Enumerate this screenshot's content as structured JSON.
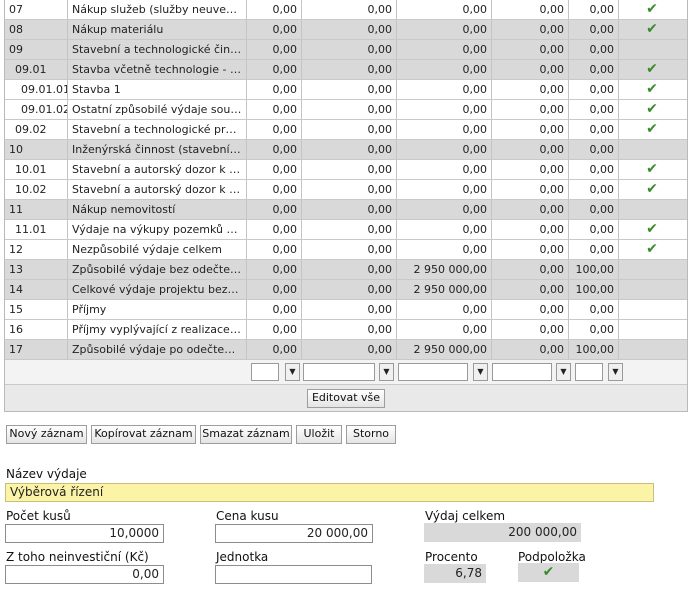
{
  "rows": [
    {
      "code": "07",
      "name": "Nákup služeb (služby neuvedené)",
      "v1": "0,00",
      "v2": "0,00",
      "v3": "0,00",
      "v4": "0,00",
      "v5": "0,00",
      "check": "✔",
      "style": "white",
      "indent": ""
    },
    {
      "code": "08",
      "name": "Nákup materiálu",
      "v1": "0,00",
      "v2": "0,00",
      "v3": "0,00",
      "v4": "0,00",
      "v5": "0,00",
      "check": "✔",
      "style": "gray",
      "indent": ""
    },
    {
      "code": "09",
      "name": "Stavební a technologické činnosti",
      "v1": "0,00",
      "v2": "0,00",
      "v3": "0,00",
      "v4": "0,00",
      "v5": "0,00",
      "check": "",
      "style": "gray",
      "indent": ""
    },
    {
      "code": "09.01",
      "name": "Stavba včetně technologie - investice",
      "v1": "0,00",
      "v2": "0,00",
      "v3": "0,00",
      "v4": "0,00",
      "v5": "0,00",
      "check": "✔",
      "style": "gray",
      "indent": "sub"
    },
    {
      "code": "09.01.01",
      "name": "Stavba 1",
      "v1": "0,00",
      "v2": "0,00",
      "v3": "0,00",
      "v4": "0,00",
      "v5": "0,00",
      "check": "✔",
      "style": "white",
      "indent": "subsub"
    },
    {
      "code": "09.01.02",
      "name": "Ostatní způsobilé výdaje souvisejí",
      "v1": "0,00",
      "v2": "0,00",
      "v3": "0,00",
      "v4": "0,00",
      "v5": "0,00",
      "check": "✔",
      "style": "white",
      "indent": "subsub"
    },
    {
      "code": "09.02",
      "name": "Stavební a technologické práce",
      "v1": "0,00",
      "v2": "0,00",
      "v3": "0,00",
      "v4": "0,00",
      "v5": "0,00",
      "check": "✔",
      "style": "white",
      "indent": "sub"
    },
    {
      "code": "10",
      "name": "Inženýrská činnost (stavební dozor)",
      "v1": "0,00",
      "v2": "0,00",
      "v3": "0,00",
      "v4": "0,00",
      "v5": "0,00",
      "check": "",
      "style": "gray",
      "indent": ""
    },
    {
      "code": "10.01",
      "name": "Stavební a autorský dozor k pořízení",
      "v1": "0,00",
      "v2": "0,00",
      "v3": "0,00",
      "v4": "0,00",
      "v5": "0,00",
      "check": "✔",
      "style": "white",
      "indent": "sub"
    },
    {
      "code": "10.02",
      "name": "Stavební a autorský dozor k neinvestičním",
      "v1": "0,00",
      "v2": "0,00",
      "v3": "0,00",
      "v4": "0,00",
      "v5": "0,00",
      "check": "✔",
      "style": "white",
      "indent": "sub"
    },
    {
      "code": "11",
      "name": "Nákup nemovitostí",
      "v1": "0,00",
      "v2": "0,00",
      "v3": "0,00",
      "v4": "0,00",
      "v5": "0,00",
      "check": "",
      "style": "gray",
      "indent": ""
    },
    {
      "code": "11.01",
      "name": "Výdaje na výkupy pozemků vč. souvisejících",
      "v1": "0,00",
      "v2": "0,00",
      "v3": "0,00",
      "v4": "0,00",
      "v5": "0,00",
      "check": "✔",
      "style": "white",
      "indent": "sub"
    },
    {
      "code": "12",
      "name": "Nezpůsobilé výdaje celkem",
      "v1": "0,00",
      "v2": "0,00",
      "v3": "0,00",
      "v4": "0,00",
      "v5": "0,00",
      "check": "✔",
      "style": "white",
      "indent": ""
    },
    {
      "code": "13",
      "name": "Způsobilé výdaje bez odečtení příjmů",
      "v1": "0,00",
      "v2": "0,00",
      "v3": "2 950 000,00",
      "v4": "0,00",
      "v5": "100,00",
      "check": "",
      "style": "gray",
      "indent": ""
    },
    {
      "code": "14",
      "name": "Celkové výdaje projektu bez odečtení",
      "v1": "0,00",
      "v2": "0,00",
      "v3": "2 950 000,00",
      "v4": "0,00",
      "v5": "100,00",
      "check": "",
      "style": "gray",
      "indent": ""
    },
    {
      "code": "15",
      "name": "Příjmy",
      "v1": "0,00",
      "v2": "0,00",
      "v3": "0,00",
      "v4": "0,00",
      "v5": "0,00",
      "check": "",
      "style": "white",
      "indent": ""
    },
    {
      "code": "16",
      "name": "Příjmy vyplývající z realizace projektu",
      "v1": "0,00",
      "v2": "0,00",
      "v3": "0,00",
      "v4": "0,00",
      "v5": "0,00",
      "check": "",
      "style": "white",
      "indent": ""
    },
    {
      "code": "17",
      "name": "Způsobilé výdaje po odečtení příjmů",
      "v1": "0,00",
      "v2": "0,00",
      "v3": "2 950 000,00",
      "v4": "0,00",
      "v5": "100,00",
      "check": "",
      "style": "gray",
      "indent": ""
    }
  ],
  "filter_arrow": "▼",
  "edit_all_label": "Editovat vše",
  "actions": {
    "new": "Nový záznam",
    "copy": "Kopírovat záznam",
    "delete": "Smazat záznam",
    "save": "Uložit",
    "cancel": "Storno"
  },
  "form": {
    "name_label": "Název výdaje",
    "name_value": "Výběrová řízení",
    "qty_label": "Počet kusů",
    "qty_value": "10,0000",
    "price_label": "Cena kusu",
    "price_value": "20 000,00",
    "total_label": "Výdaj celkem",
    "total_value": "200 000,00",
    "noninvest_label": "Z toho neinvestiční (Kč)",
    "noninvest_value": "0,00",
    "unit_label": "Jednotka",
    "unit_value": "",
    "percent_label": "Procento",
    "percent_value": "6,78",
    "subitem_label": "Podpoložka",
    "subitem_check": "✔"
  },
  "colors": {
    "check": "#3a8a2a",
    "highlight": "#fbf3a6",
    "gray_row": "#d9d9d9"
  }
}
